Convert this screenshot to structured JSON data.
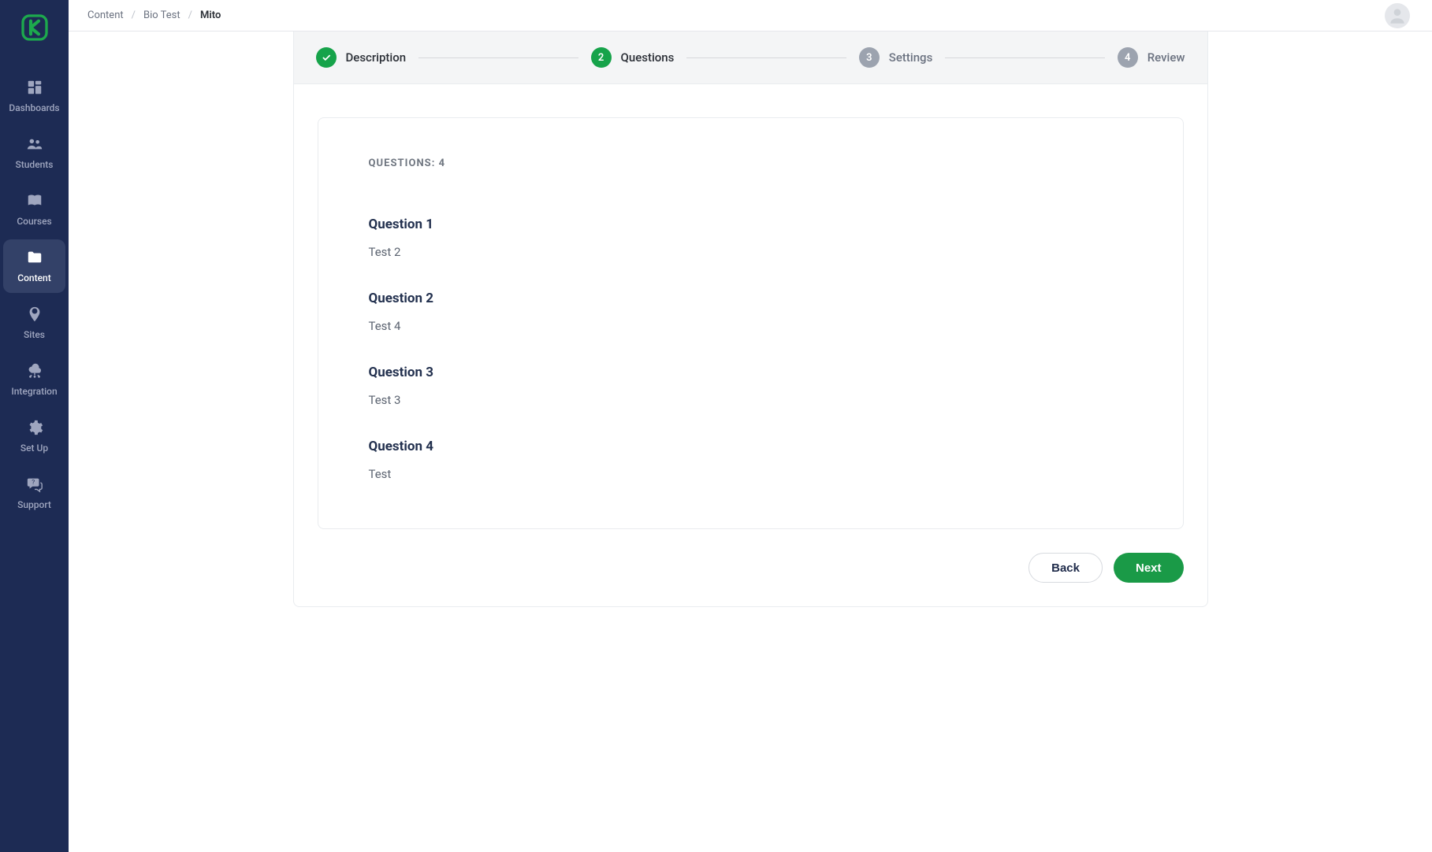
{
  "sidebar": {
    "items": [
      {
        "label": "Dashboards"
      },
      {
        "label": "Students"
      },
      {
        "label": "Courses"
      },
      {
        "label": "Content"
      },
      {
        "label": "Sites"
      },
      {
        "label": "Integration"
      },
      {
        "label": "Set Up"
      },
      {
        "label": "Support"
      }
    ],
    "activeIndex": 3
  },
  "breadcrumb": {
    "items": [
      "Content",
      "Bio Test",
      "Mito"
    ]
  },
  "stepper": {
    "steps": [
      {
        "label": "Description",
        "state": "completed"
      },
      {
        "label": "Questions",
        "state": "active",
        "num": "2"
      },
      {
        "label": "Settings",
        "state": "pending",
        "num": "3"
      },
      {
        "label": "Review",
        "state": "pending",
        "num": "4"
      }
    ]
  },
  "questions": {
    "countLabel": "QUESTIONS: 4",
    "list": [
      {
        "title": "Question 1",
        "text": "Test 2"
      },
      {
        "title": "Question 2",
        "text": "Test 4"
      },
      {
        "title": "Question 3",
        "text": "Test 3"
      },
      {
        "title": "Question 4",
        "text": "Test"
      }
    ]
  },
  "footer": {
    "backLabel": "Back",
    "nextLabel": "Next"
  },
  "colors": {
    "brandGreen": "#1da94d",
    "stepActive": "#16a34a",
    "stepInactive": "#9ca3af",
    "sidebarBg": "#1d2b54"
  }
}
